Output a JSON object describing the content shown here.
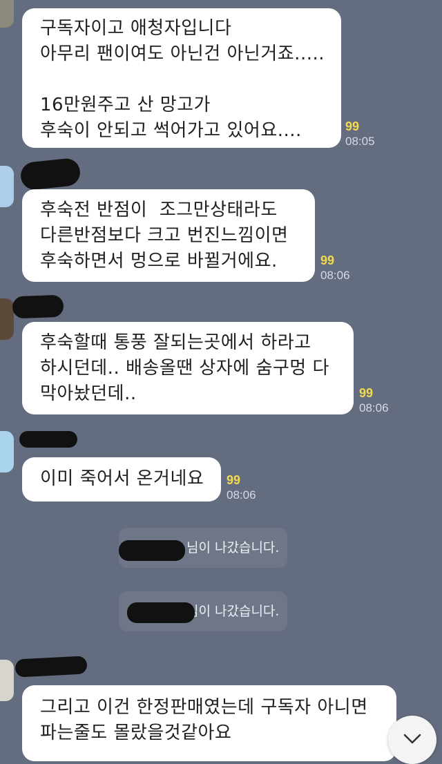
{
  "messages": [
    {
      "lines": [
        "구독자이고 애청자입니다",
        "아무리 팬이여도 아닌건 아닌거죠.....",
        "",
        "16만원주고 산 망고가",
        "후숙이 안되고 썩어가고 있어요...."
      ],
      "read_count": "99",
      "time": "08:05"
    },
    {
      "lines": [
        "후숙전 반점이  조그만상태라도",
        "다른반점보다 크고 번진느낌이면",
        "후숙하면서 멍으로 바뀔거에요."
      ],
      "read_count": "99",
      "time": "08:06"
    },
    {
      "lines": [
        "후숙할때 통풍 잘되는곳에서 하라고",
        "하시던데.. 배송올땐 상자에 숨구멍 다",
        "막아놨던데.."
      ],
      "read_count": "99",
      "time": "08:06"
    },
    {
      "lines": [
        "이미 죽어서 온거네요"
      ],
      "read_count": "99",
      "time": "08:06"
    },
    {
      "lines": [
        "그리고 이건 한정판매였는데 구독자 아니면",
        "파는줄도 몰랐을것같아요"
      ]
    }
  ],
  "system_notices": [
    {
      "text": "님이 나갔습니다."
    },
    {
      "text": "님이 나갔습니다."
    }
  ],
  "scroll_button": {
    "icon": "chevron-down-icon"
  }
}
